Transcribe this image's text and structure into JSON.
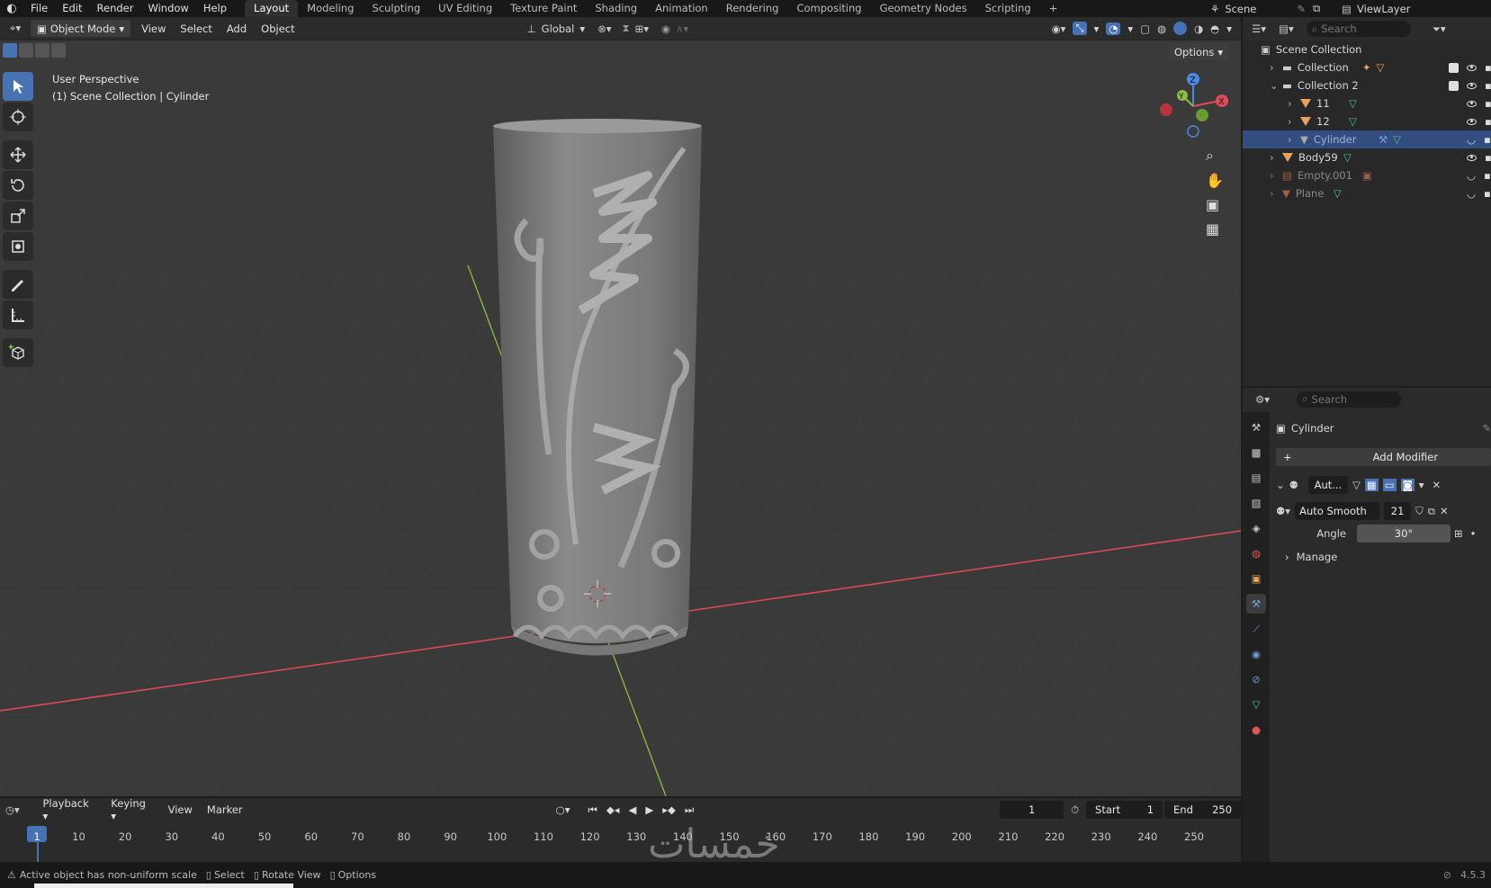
{
  "menu": {
    "file": "File",
    "edit": "Edit",
    "render": "Render",
    "window": "Window",
    "help": "Help"
  },
  "workspaces": [
    {
      "label": "Layout"
    },
    {
      "label": "Modeling"
    },
    {
      "label": "Sculpting"
    },
    {
      "label": "UV Editing"
    },
    {
      "label": "Texture Paint"
    },
    {
      "label": "Shading"
    },
    {
      "label": "Animation"
    },
    {
      "label": "Rendering"
    },
    {
      "label": "Compositing"
    },
    {
      "label": "Geometry Nodes"
    },
    {
      "label": "Scripting"
    }
  ],
  "scene_name": "Scene",
  "view_layer": "ViewLayer",
  "header": {
    "mode": "Object Mode",
    "view": "View",
    "select": "Select",
    "add": "Add",
    "object": "Object",
    "orientation": "Global",
    "options": "Options"
  },
  "viewport": {
    "perspective": "User Perspective",
    "context": "(1) Scene Collection | Cylinder"
  },
  "gizmo": {
    "x": "X",
    "y": "Y",
    "z": "Z"
  },
  "outliner": {
    "search_placeholder": "Search",
    "root": "Scene Collection",
    "items": [
      {
        "label": "Collection"
      },
      {
        "label": "Collection 2"
      },
      {
        "label": "11"
      },
      {
        "label": "12"
      },
      {
        "label": "Cylinder"
      },
      {
        "label": "Body59"
      },
      {
        "label": "Empty.001"
      },
      {
        "label": "Plane"
      }
    ]
  },
  "properties": {
    "search_placeholder": "Search",
    "object_name": "Cylinder",
    "add_modifier": "Add Modifier",
    "modifier_short": "Aut...",
    "node_group": "Auto Smooth",
    "node_users": "21",
    "angle_label": "Angle",
    "angle_value": "30°",
    "manage": "Manage"
  },
  "timeline": {
    "playback": "Playback",
    "keying": "Keying",
    "view": "View",
    "marker": "Marker",
    "current_frame": "1",
    "start_label": "Start",
    "start": "1",
    "end_label": "End",
    "end": "250",
    "ticks": [
      "1",
      "10",
      "20",
      "30",
      "40",
      "50",
      "60",
      "70",
      "80",
      "90",
      "100",
      "110",
      "120",
      "130",
      "140",
      "150",
      "160",
      "170",
      "180",
      "190",
      "200",
      "210",
      "220",
      "230",
      "240",
      "250"
    ]
  },
  "status": {
    "warning": "Active object has non-uniform scale",
    "select": "Select",
    "rotate": "Rotate View",
    "options": "Options",
    "version": "4.5.3"
  },
  "watermark": "خمسات",
  "colors": {
    "accent": "#4772b3",
    "selected_row": "#334d80",
    "x_axis": "#e04a5a",
    "y_axis": "#8cbf3f",
    "z_axis": "#4a8ae0"
  }
}
